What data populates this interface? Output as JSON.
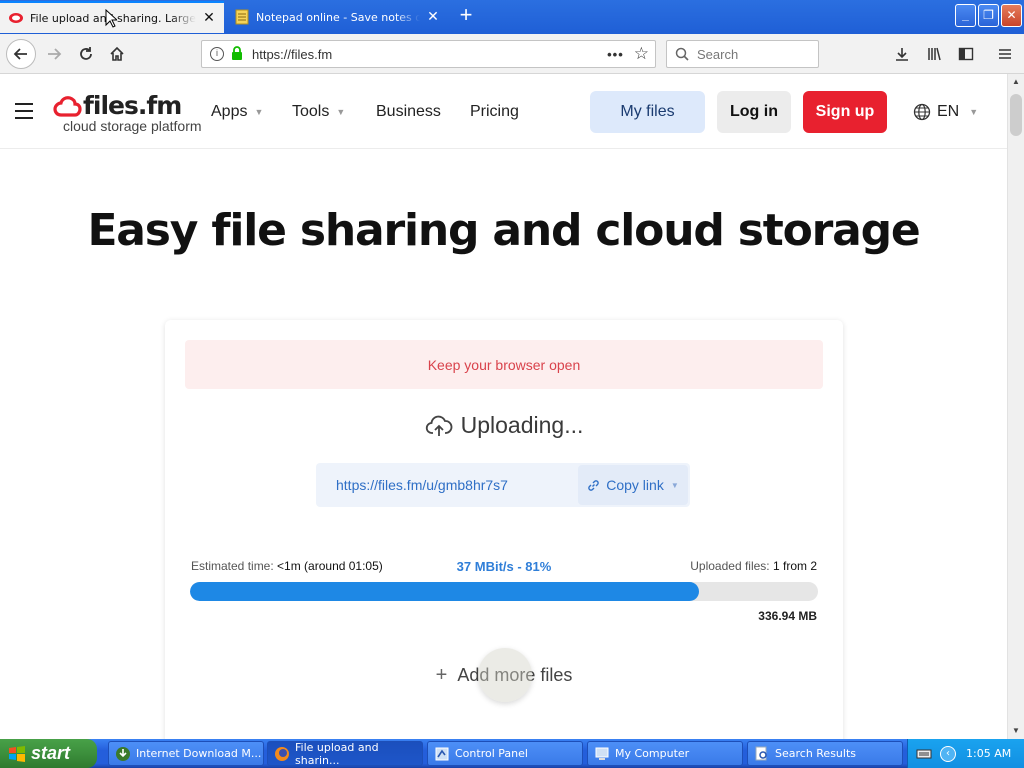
{
  "browser": {
    "tabs": [
      {
        "title": "File upload and sharing. Large file",
        "active": true
      },
      {
        "title": "Notepad online - Save notes onlin",
        "active": false
      }
    ],
    "url": "https://files.fm",
    "search_placeholder": "Search"
  },
  "site": {
    "logo_name": "files.fm",
    "logo_tagline": "cloud storage platform",
    "menu": {
      "apps": "Apps",
      "tools": "Tools",
      "business": "Business",
      "pricing": "Pricing"
    },
    "buttons": {
      "my_files": "My files",
      "log_in": "Log in",
      "sign_up": "Sign up"
    },
    "language": "EN",
    "hero_title": "Easy file sharing and cloud storage",
    "colors": {
      "accent": "#1e88e5",
      "signup": "#e8212f",
      "notice_text": "#d9434c"
    }
  },
  "upload": {
    "notice": "Keep your browser open",
    "status": "Uploading...",
    "share_url": "https://files.fm/u/gmb8hr7s7",
    "copy_link": "Copy link",
    "estimated_label": "Estimated time:",
    "estimated_value": "<1m (around 01:05)",
    "speed": "37 MBit/s - 81%",
    "uploaded_label": "Uploaded files:",
    "uploaded_value": "1 from 2",
    "progress_percent": 81,
    "size": "336.94 MB",
    "add_more": "Add more files"
  },
  "taskbar": {
    "start": "start",
    "items": [
      {
        "label": "Internet Download M...",
        "active": false
      },
      {
        "label": "File upload and sharin...",
        "active": true
      },
      {
        "label": "Control Panel",
        "active": false
      },
      {
        "label": "My Computer",
        "active": false
      },
      {
        "label": "Search Results",
        "active": false
      }
    ],
    "clock": "1:05 AM"
  }
}
